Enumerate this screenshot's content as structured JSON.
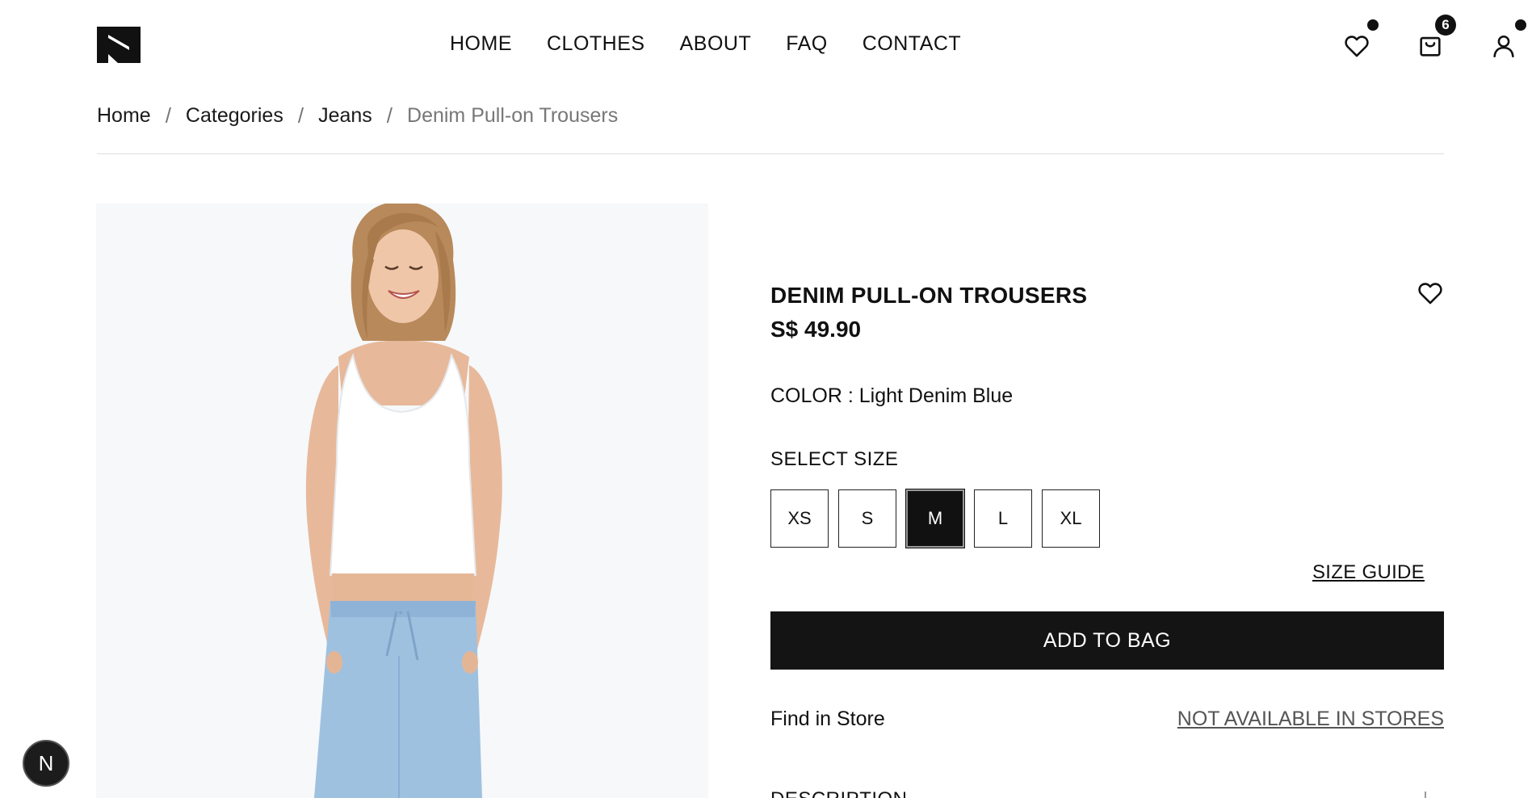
{
  "nav": {
    "items": [
      "HOME",
      "CLOTHES",
      "ABOUT",
      "FAQ",
      "CONTACT"
    ]
  },
  "header_icons": {
    "wishlist": "heart-icon",
    "cart": "bag-icon",
    "cart_count": "6",
    "account": "user-icon"
  },
  "breadcrumb": {
    "items": [
      "Home",
      "Categories",
      "Jeans"
    ],
    "current": "Denim Pull-on Trousers",
    "separator": "/"
  },
  "product": {
    "title": "DENIM PULL-ON TROUSERS",
    "price": "S$ 49.90",
    "color_label": "COLOR : Light Denim Blue",
    "select_size_label": "SELECT SIZE",
    "sizes": [
      "XS",
      "S",
      "M",
      "L",
      "XL"
    ],
    "selected_size": "M",
    "size_guide": "SIZE GUIDE",
    "add_to_bag": "ADD TO BAG",
    "find_in_store": "Find in Store",
    "store_availability": "NOT AVAILABLE IN STORES",
    "description_label": "DESCRIPTION"
  },
  "floating_badge": {
    "label": "N"
  },
  "colors": {
    "primary": "#111111",
    "muted": "#777777",
    "image_bg": "#f6f8fa",
    "jeans": "#9fc1e0"
  }
}
